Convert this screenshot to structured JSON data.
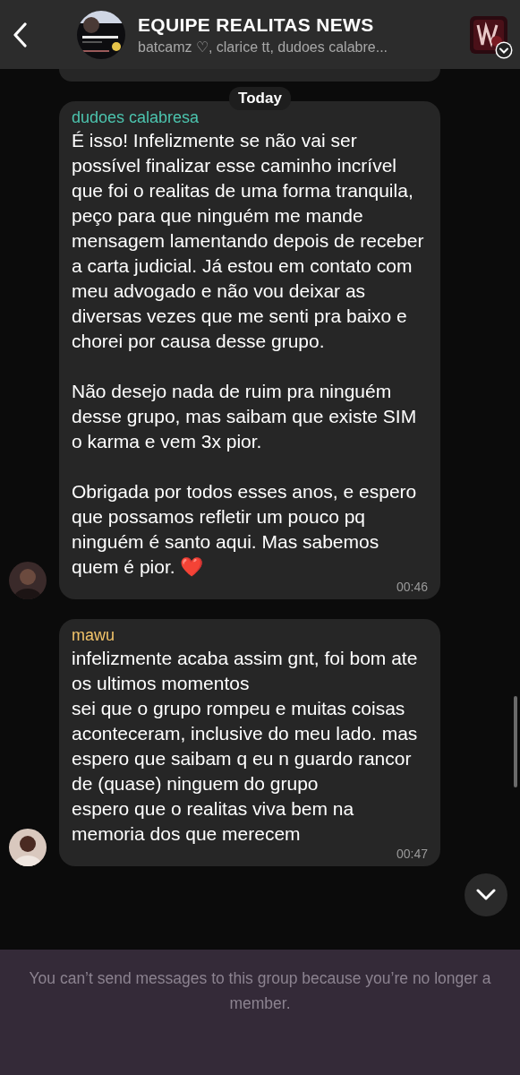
{
  "header": {
    "title": "EQUIPE REALITAS NEWS",
    "members": "batcamz ♡, clarice tt, dudoes calabre..."
  },
  "date_label": "Today",
  "messages": [
    {
      "sender": "dudoes calabresa",
      "color": "#4cc4ae",
      "text": "É isso! Infelizmente se não vai ser possível finalizar esse caminho incrível que foi o realitas de uma forma tranquila, peço para que ninguém me mande mensagem lamentando depois de receber a carta judicial. Já estou em contato com meu advogado e não vou deixar as diversas vezes que me senti pra baixo e chorei por causa desse grupo.\n\nNão desejo nada de ruim pra ninguém desse grupo, mas saibam que existe SIM o karma e vem 3x pior.\n\nObrigada por todos esses anos, e espero que possamos refletir um pouco pq ninguém é santo aqui. Mas sabemos quem é pior. ❤️",
      "time": "00:46"
    },
    {
      "sender": "mawu",
      "color": "#f2c46a",
      "text": "infelizmente acaba assim gnt, foi bom ate os ultimos momentos\nsei que o grupo rompeu e muitas coisas aconteceram, inclusive do meu lado. mas espero que saibam q eu n guardo rancor de (quase) ninguem do grupo\nespero que o realitas viva bem na memoria dos que merecem",
      "time": "00:47"
    }
  ],
  "notice": "You can’t send messages to this group because you’re no longer a member."
}
